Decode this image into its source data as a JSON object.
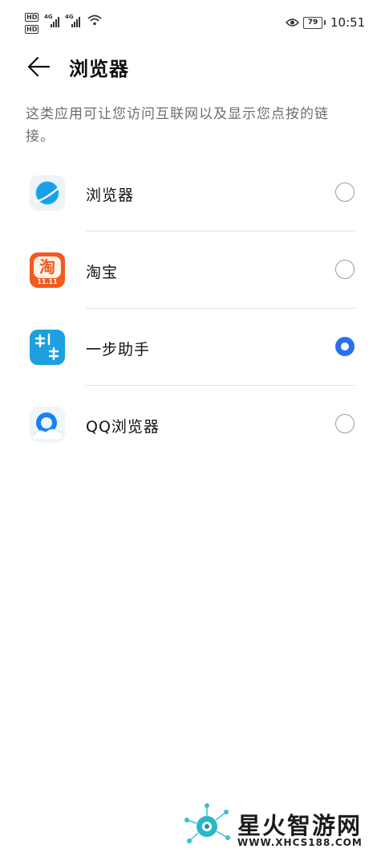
{
  "status_bar": {
    "hd1": "HD",
    "hd2": "HD",
    "net1": "4G",
    "net2": "4G",
    "battery": "79",
    "time": "10:51"
  },
  "header": {
    "title": "浏览器"
  },
  "description": "这类应用可让您访问互联网以及显示您点按的链接。",
  "apps": [
    {
      "label": "浏览器",
      "icon": "browser-icon",
      "selected": false
    },
    {
      "label": "淘宝",
      "icon": "taobao-icon",
      "selected": false,
      "icon_text": "淘",
      "icon_sub": "11.11"
    },
    {
      "label": "一步助手",
      "icon": "yibu-assistant-icon",
      "selected": true
    },
    {
      "label": "QQ浏览器",
      "icon": "qq-browser-icon",
      "selected": false
    }
  ],
  "watermark": {
    "name": "星火智游网",
    "url": "WWW.XHCS188.COM"
  },
  "colors": {
    "accent": "#2a6ff0",
    "taobao": "#f25a1e",
    "yibu": "#1e9fe0"
  }
}
